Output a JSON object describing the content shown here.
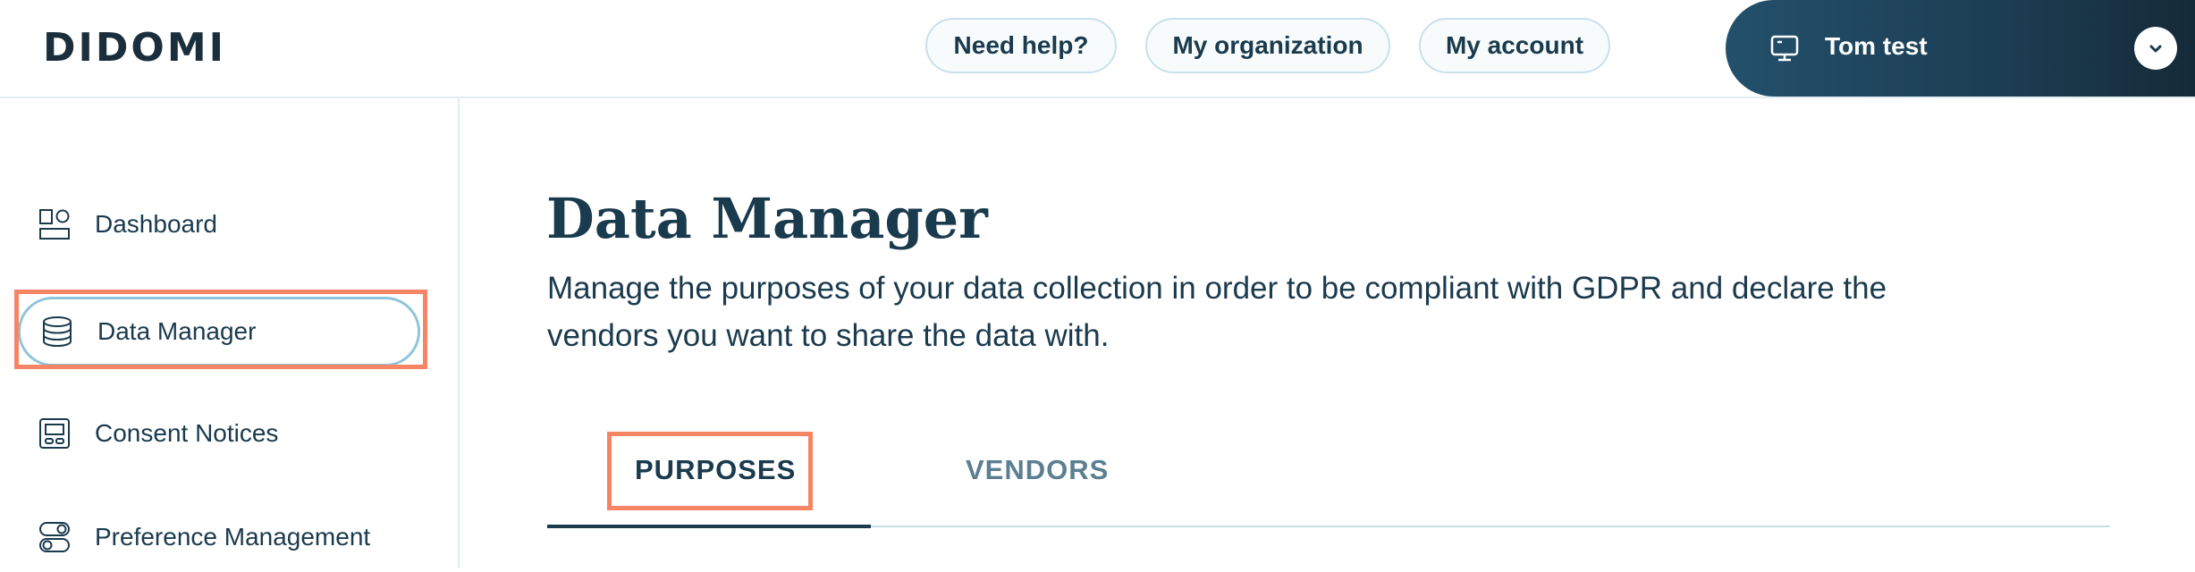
{
  "header": {
    "logo": "DIDOMI",
    "help_label": "Need help?",
    "organization_label": "My organization",
    "account_label": "My account",
    "user_name": "Tom test"
  },
  "sidebar": {
    "items": [
      {
        "label": "Dashboard",
        "icon": "dashboard-icon"
      },
      {
        "label": "Data Manager",
        "icon": "database-icon",
        "active": true
      },
      {
        "label": "Consent Notices",
        "icon": "consent-notice-icon"
      },
      {
        "label": "Preference Management",
        "icon": "toggles-icon"
      }
    ]
  },
  "main": {
    "title": "Data Manager",
    "description": "Manage the purposes of your data collection in order to be compliant with GDPR and declare the vendors you want to share the data with.",
    "tabs": [
      {
        "label": "PURPOSES",
        "active": true
      },
      {
        "label": "VENDORS",
        "active": false
      }
    ]
  },
  "colors": {
    "primary_text": "#1a3a4d",
    "highlight": "#f58564",
    "user_box": "#1c3d52"
  }
}
